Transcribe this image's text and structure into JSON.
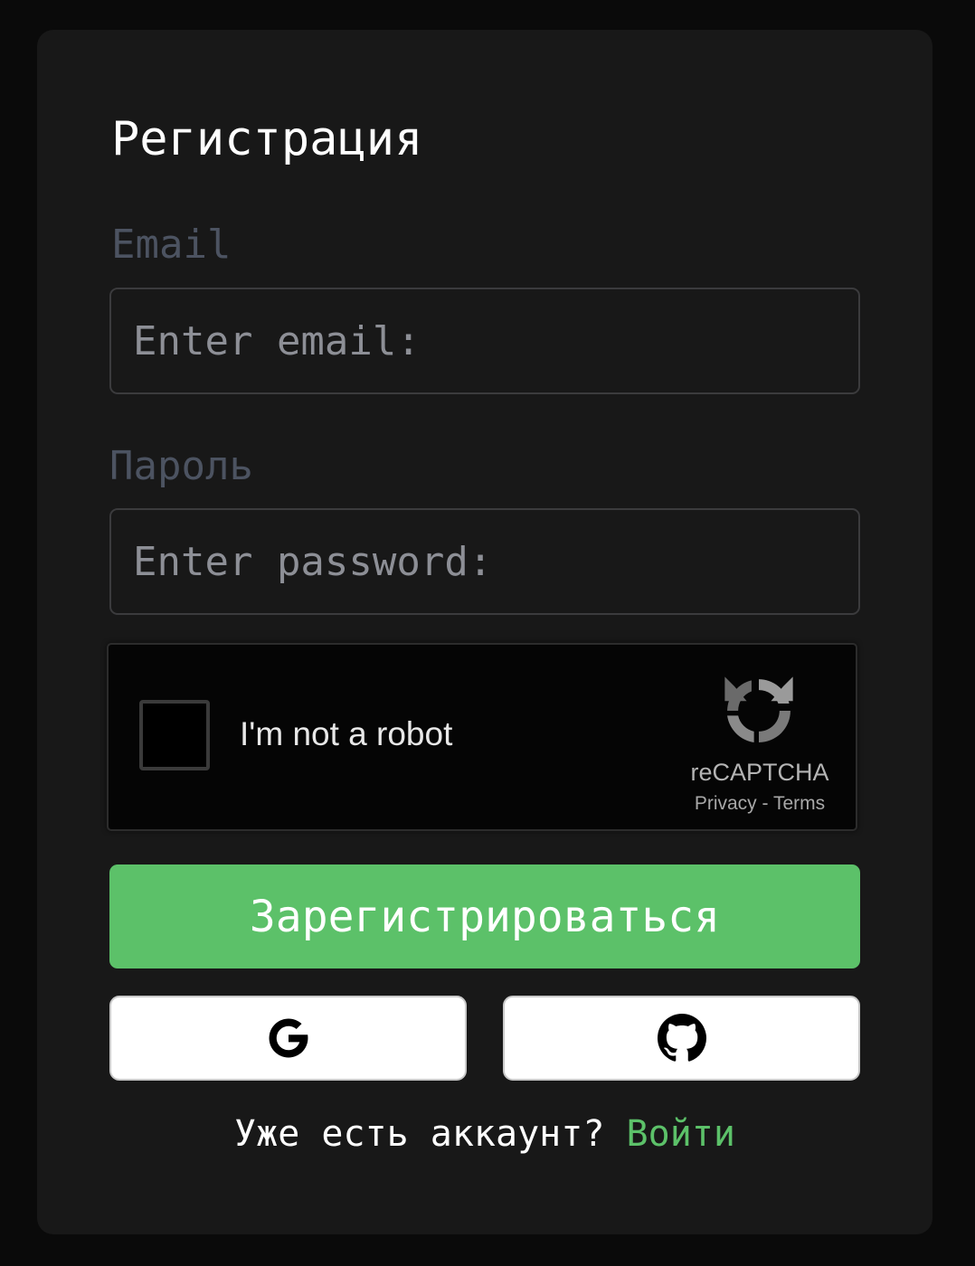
{
  "form": {
    "title": "Регистрация",
    "email_label": "Email",
    "email_placeholder": "Enter email:",
    "email_value": "",
    "password_label": "Пароль",
    "password_placeholder": "Enter password:",
    "password_value": "",
    "register_label": "Зарегистрироваться",
    "footer_text": "Уже есть аккаунт?",
    "login_link": "Войти"
  },
  "captcha": {
    "checkbox_label": "I'm not a robot",
    "brand": "reCAPTCHA",
    "privacy": "Privacy",
    "separator": "-",
    "terms": "Terms",
    "checked": false
  },
  "oauth": [
    {
      "provider": "google",
      "icon": "google-icon"
    },
    {
      "provider": "github",
      "icon": "github-icon"
    }
  ],
  "colors": {
    "page_bg": "#0a0a0a",
    "card_bg": "#181818",
    "accent": "#5cc169",
    "label": "#4c5361",
    "placeholder": "#8d8f96"
  }
}
